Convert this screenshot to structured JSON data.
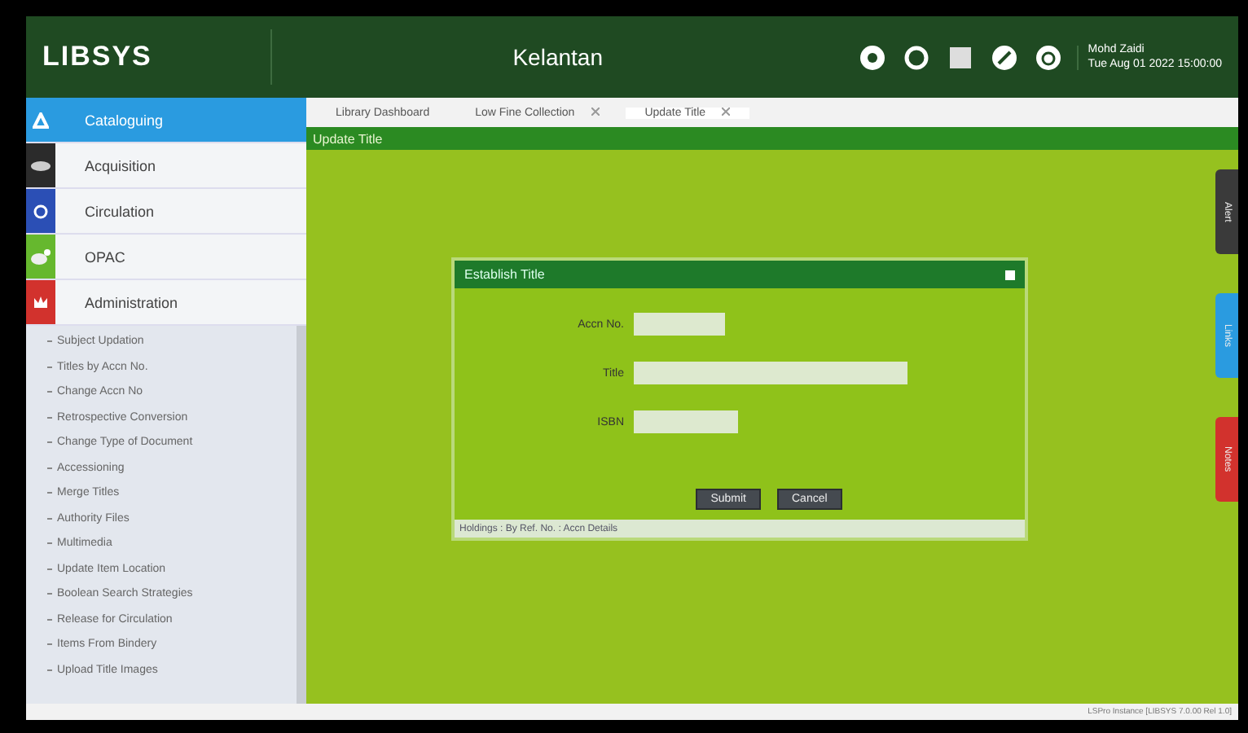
{
  "header": {
    "logo": "LIBSYS",
    "library": "Kelantan",
    "user_name": "Mohd Zaidi",
    "user_date": "Tue Aug 01 2022 15:00:00"
  },
  "modules": [
    {
      "label": "Cataloguing",
      "selected": true,
      "color": "#2a9be0"
    },
    {
      "label": "Acquisition",
      "selected": false,
      "color": "#2b2b2b"
    },
    {
      "label": "Circulation",
      "selected": false,
      "color": "#2b4fb5"
    },
    {
      "label": "OPAC",
      "selected": false,
      "color": "#66b82e"
    },
    {
      "label": "Administration",
      "selected": false,
      "color": "#d2322d"
    }
  ],
  "submenu": [
    "Subject Updation",
    "Titles by Accn No.",
    "Change Accn No",
    "Retrospective Conversion",
    "Change Type of Document",
    "Accessioning",
    "Merge Titles",
    "Authority Files",
    "Multimedia",
    "Update Item Location",
    "Boolean Search Strategies",
    "Release for Circulation",
    "Items From Bindery",
    "Upload Title Images"
  ],
  "tabs": [
    {
      "label": "Library Dashboard",
      "closable": false,
      "selected": false
    },
    {
      "label": "Low Fine Collection",
      "closable": true,
      "selected": false
    },
    {
      "label": "Update Title",
      "closable": true,
      "selected": true
    }
  ],
  "page_title": "Update Title",
  "dialog": {
    "title": "Establish Title",
    "fields": [
      {
        "label": "Accn No."
      },
      {
        "label": "Title"
      },
      {
        "label": "ISBN"
      }
    ],
    "buttons": [
      "Submit",
      "Cancel"
    ],
    "footer": "Holdings : By Ref. No. : Accn Details"
  },
  "side_tabs": [
    {
      "label": "Alert",
      "color": "#3a3a3a"
    },
    {
      "label": "Links",
      "color": "#2a9be0"
    },
    {
      "label": "Notes",
      "color": "#d2322d"
    }
  ],
  "status_bar": "LSPro Instance [LIBSYS 7.0.00 Rel 1.0]"
}
